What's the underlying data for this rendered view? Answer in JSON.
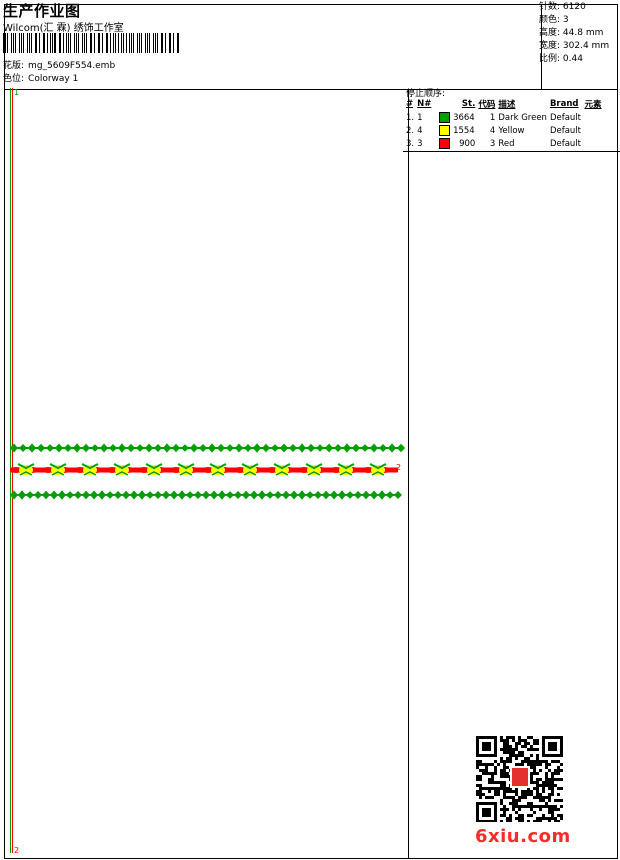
{
  "header": {
    "title": "生产作业图",
    "company": "Wilcom(汇 霖) 绣饰工作室",
    "file_label": "花版:",
    "file_name": "mg_5609F554.emb",
    "colorway_label": "色位:",
    "colorway_name": "Colorway 1"
  },
  "stats": [
    {
      "label": "针数:",
      "value": "6120"
    },
    {
      "label": "颜色:",
      "value": "3"
    },
    {
      "label": "高度:",
      "value": "44.8 mm"
    },
    {
      "label": "宽度:",
      "value": "302.4 mm"
    },
    {
      "label": "比例:",
      "value": "0.44"
    }
  ],
  "sequence": {
    "title": "停止顺序:",
    "headers": [
      "#",
      "N#",
      "St.",
      "代码",
      "描述",
      "Brand",
      "元素"
    ],
    "rows": [
      {
        "num": "1.",
        "n": "1",
        "st": "3664",
        "code": "1",
        "desc": "Dark Green",
        "brand": "Default",
        "color": "#00a000"
      },
      {
        "num": "2.",
        "n": "4",
        "st": "1554",
        "code": "4",
        "desc": "Yellow",
        "brand": "Default",
        "color": "#ffff00"
      },
      {
        "num": "3.",
        "n": "3",
        "st": "900",
        "code": "3",
        "desc": "Red",
        "brand": "Default",
        "color": "#ff0000"
      }
    ]
  },
  "markers": {
    "top_left": "1",
    "bottom_left": "2",
    "right": "2"
  },
  "colors": {
    "green": "#00a000",
    "yellow": "#ffff00",
    "red": "#ff0000",
    "ruler_green": "#00a000",
    "ruler_red": "#ff0000"
  },
  "watermark": "6xiu.com"
}
